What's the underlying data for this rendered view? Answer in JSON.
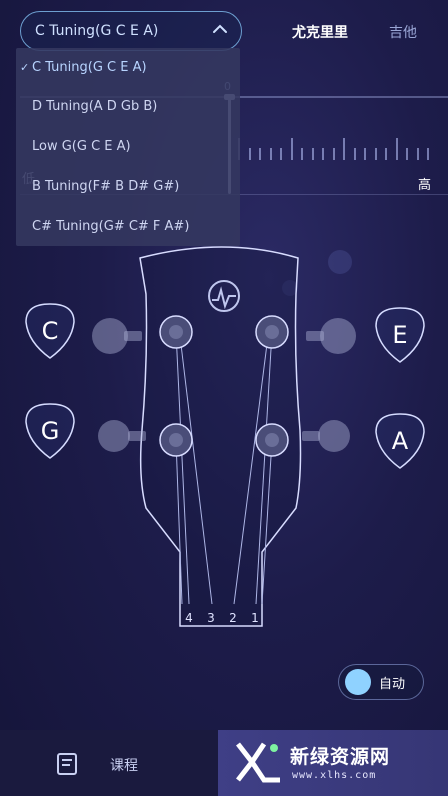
{
  "header": {
    "selected_tuning": "C Tuning(G C E A)",
    "instrument_tabs": [
      "尤克里里",
      "吉他"
    ]
  },
  "meter": {
    "center_value": "0",
    "low_label": "低",
    "high_label": "高"
  },
  "dropdown": {
    "items": [
      {
        "label": "C Tuning(G C E A)",
        "selected": true
      },
      {
        "label": "D Tuning(A D Gb B)",
        "selected": false
      },
      {
        "label": "Low G(G C E A)",
        "selected": false
      },
      {
        "label": "B Tuning(F# B D# G#)",
        "selected": false
      },
      {
        "label": "C# Tuning(G# C# F A#)",
        "selected": false
      }
    ],
    "check_mark": "✓"
  },
  "strings": {
    "left_top": "C",
    "left_bottom": "G",
    "right_top": "E",
    "right_bottom": "A",
    "numbers": [
      "4",
      "3",
      "2",
      "1"
    ]
  },
  "auto_toggle": {
    "label": "自动",
    "on": true
  },
  "bottom_nav": {
    "course_label": "课程",
    "course_icon": "document-icon",
    "watermark_text": "新绿资源网",
    "watermark_url": "www.xlhs.com"
  },
  "colors": {
    "background": "#1d1c4a",
    "accent": "#6d9fd0",
    "toggle_knob": "#8fd2ff"
  }
}
